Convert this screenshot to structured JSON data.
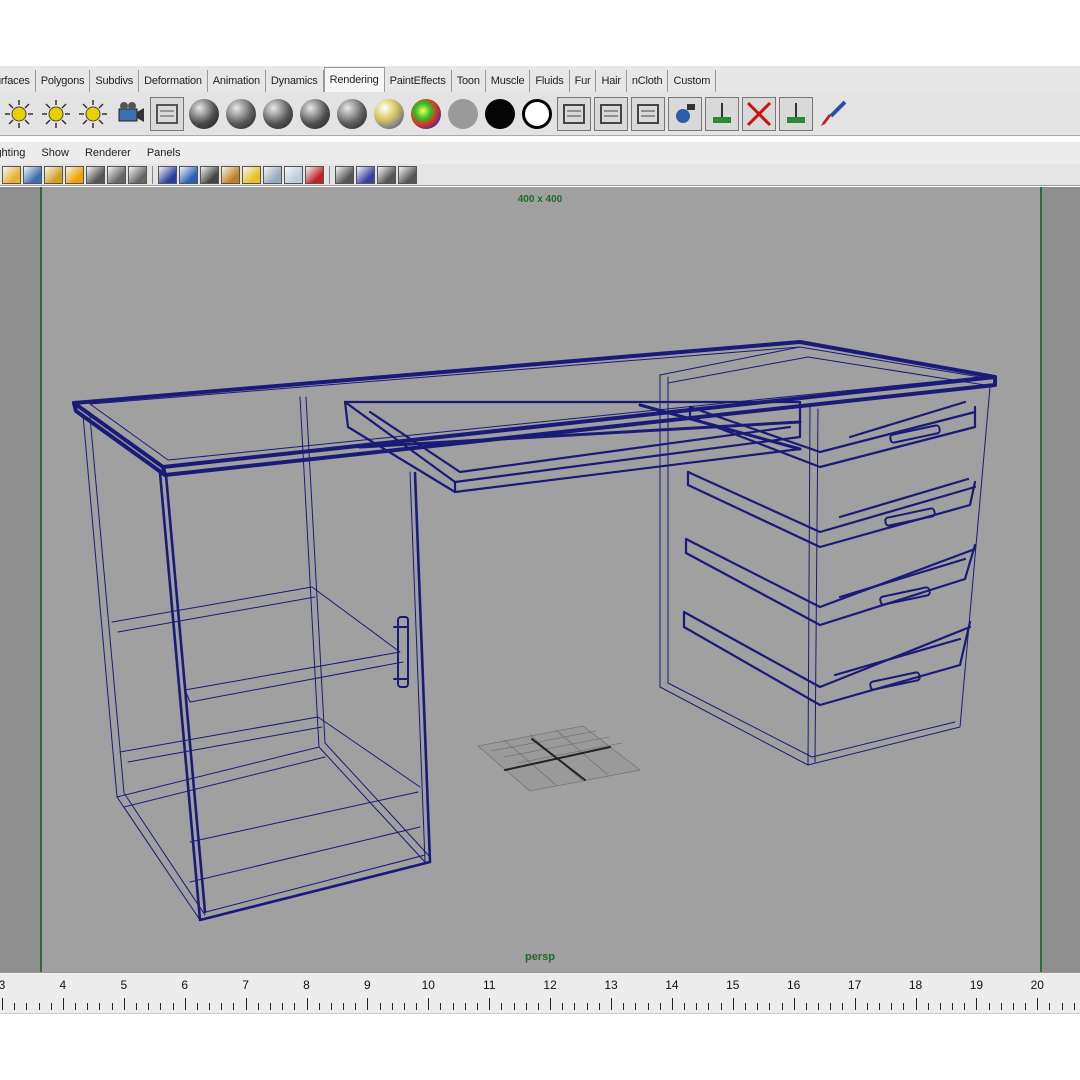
{
  "shelf": {
    "tabs": [
      "urfaces",
      "Polygons",
      "Subdivs",
      "Deformation",
      "Animation",
      "Dynamics",
      "Rendering",
      "PaintEffects",
      "Toon",
      "Muscle",
      "Fluids",
      "Fur",
      "Hair",
      "nCloth",
      "Custom"
    ],
    "active_tab": "Rendering",
    "icons": [
      {
        "name": "spot-light-icon",
        "kind": "light",
        "color": "#e8d000"
      },
      {
        "name": "point-light-icon",
        "kind": "light",
        "color": "#e8d000"
      },
      {
        "name": "ambient-light-icon",
        "kind": "light",
        "color": "#e8d000"
      },
      {
        "name": "camera-icon",
        "kind": "camera",
        "color": "#3a6fb0"
      },
      {
        "name": "hypershade-icon",
        "kind": "box",
        "color": "#555555"
      },
      {
        "name": "lambert-sphere-icon",
        "kind": "sphere",
        "color": "#4a4a4a"
      },
      {
        "name": "blinn-sphere-icon",
        "kind": "sphere",
        "color": "#5a5a5a"
      },
      {
        "name": "phong-sphere-icon",
        "kind": "sphere",
        "color": "#555555"
      },
      {
        "name": "phong-e-sphere-icon",
        "kind": "sphere",
        "color": "#505050"
      },
      {
        "name": "anisotropic-sphere-icon",
        "kind": "sphere",
        "color": "#5c5c5c"
      },
      {
        "name": "ramp-shader-sphere-icon",
        "kind": "sphere-ramp",
        "color": "#d8c860"
      },
      {
        "name": "rainbow-shader-sphere-icon",
        "kind": "sphere-rainbow",
        "color": "#e03020"
      },
      {
        "name": "gray-sphere-icon",
        "kind": "sphere-flat",
        "color": "#9a9a9a"
      },
      {
        "name": "black-sphere-icon",
        "kind": "sphere-flat",
        "color": "#050505"
      },
      {
        "name": "white-sphere-icon",
        "kind": "sphere-ring",
        "color": "#ffffff"
      },
      {
        "name": "render-view-icon",
        "kind": "box",
        "color": "#444444"
      },
      {
        "name": "render-current-frame-icon",
        "kind": "box",
        "color": "#444444"
      },
      {
        "name": "ipr-render-icon",
        "kind": "box",
        "color": "#444444"
      },
      {
        "name": "batch-render-icon",
        "kind": "box-blue",
        "color": "#2a5fa8"
      },
      {
        "name": "render-settings-icon",
        "kind": "box-green",
        "color": "#2a8a3a"
      },
      {
        "name": "cancel-render-icon",
        "kind": "box-x",
        "color": "#cc1010"
      },
      {
        "name": "show-batch-render-icon",
        "kind": "box-green",
        "color": "#2a8a3a"
      },
      {
        "name": "paint-brush-icon",
        "kind": "brush",
        "color": "#c02020"
      }
    ]
  },
  "panel_menu": [
    "ighting",
    "Show",
    "Renderer",
    "Panels"
  ],
  "panel_toolbar": {
    "icons": [
      "select-camera-icon",
      "camera-attributes-icon",
      "bookmark-icon",
      "image-plane-icon",
      "grid-icon",
      "film-gate-icon",
      "resolution-gate-icon",
      "wireframe-icon",
      "smooth-shade-icon",
      "wireframe-on-shaded-icon",
      "textured-icon",
      "use-all-lights-icon",
      "shadows-icon",
      "xray-icon",
      "isolate-select-icon",
      "high-quality-icon",
      "hud-icon",
      "safe-title-icon",
      "field-chart-icon"
    ]
  },
  "viewport": {
    "resolution_label": "400 x 400",
    "camera_label": "persp",
    "wire_color": "#1a1a78",
    "background": "#a0a0a0",
    "gate_color": "#2f6a3a"
  },
  "timeslider": {
    "numbers": [
      "3",
      "4",
      "5",
      "6",
      "7",
      "8",
      "9",
      "10",
      "11",
      "12",
      "13",
      "14",
      "15",
      "16",
      "17",
      "18",
      "19",
      "20"
    ]
  }
}
